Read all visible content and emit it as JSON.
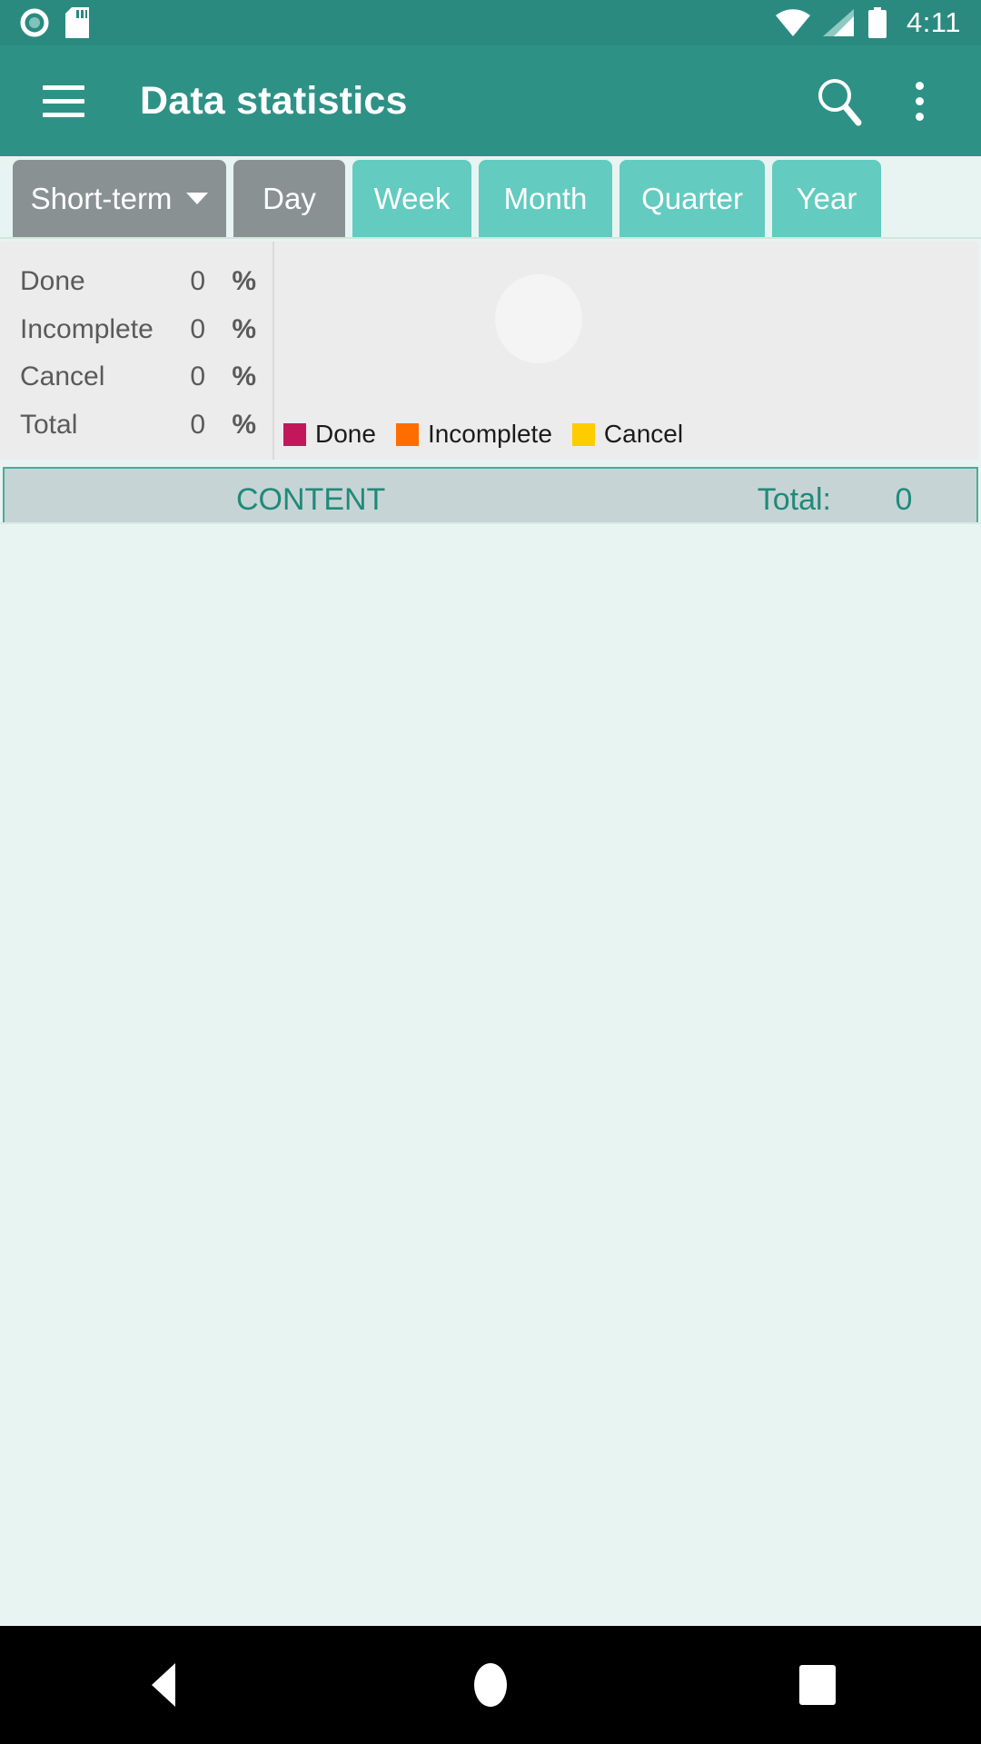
{
  "status_bar": {
    "time": "4:11",
    "icons": [
      "record-circle-icon",
      "sd-card-icon",
      "wifi-icon",
      "cell-signal-icon",
      "battery-icon"
    ]
  },
  "app_bar": {
    "title": "Data statistics",
    "menu_icon": "hamburger-icon",
    "search_icon": "search-icon",
    "overflow_icon": "overflow-menu-icon"
  },
  "tabs": {
    "selector": {
      "label": "Short-term",
      "caret": "chevron-down-icon",
      "selected": true
    },
    "items": [
      {
        "label": "Day",
        "active": true
      },
      {
        "label": "Week",
        "active": false
      },
      {
        "label": "Month",
        "active": false
      },
      {
        "label": "Quarter",
        "active": false
      },
      {
        "label": "Year",
        "active": false
      }
    ]
  },
  "summary": {
    "rows": [
      {
        "label": "Done",
        "value": "0",
        "pct": "%"
      },
      {
        "label": "Incomplete",
        "value": "0",
        "pct": "%"
      },
      {
        "label": "Cancel",
        "value": "0",
        "pct": "%"
      },
      {
        "label": "Total",
        "value": "0",
        "pct": "%"
      }
    ]
  },
  "chart_data": {
    "type": "pie",
    "title": "",
    "categories": [
      "Done",
      "Incomplete",
      "Cancel"
    ],
    "values": [
      0,
      0,
      0
    ],
    "colors": [
      "#C2185B",
      "#FF6D00",
      "#FFCC00"
    ],
    "empty_state_color": "#F4F4F4",
    "legend_position": "bottom-left",
    "legend": [
      {
        "label": "Done",
        "color": "#C2185B"
      },
      {
        "label": "Incomplete",
        "color": "#FF6D00"
      },
      {
        "label": "Cancel",
        "color": "#FFCC00"
      }
    ]
  },
  "content_header": {
    "title": "CONTENT",
    "total_label": "Total:",
    "total_value": "0"
  },
  "content_list": {
    "items": []
  },
  "nav_bar": {
    "back": "back-triangle-icon",
    "home": "home-circle-icon",
    "recents": "recents-square-icon"
  },
  "theme": {
    "status_bar_bg": "#2B8A80",
    "app_bar_bg": "#2E9186",
    "tab_active_bg": "#63CBC0",
    "tab_selected_bg": "#8A9193",
    "page_bg": "#E8F4F1",
    "panel_bg": "#ECECEC",
    "content_header_bg": "#C7D4D5",
    "accent_text": "#1F8A7A"
  }
}
